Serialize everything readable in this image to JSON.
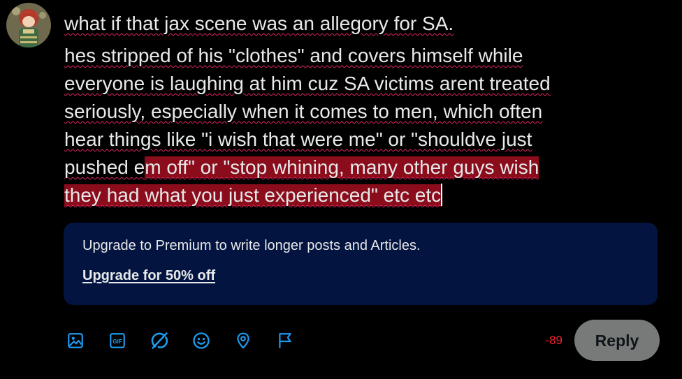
{
  "avatar": {
    "icon": "user-avatar"
  },
  "composer": {
    "lines": [
      "what if that jax scene was an allegory for SA.",
      "hes stripped of his \"clothes\" and covers himself while",
      "everyone is laughing at him cuz SA victims arent treated",
      "seriously, especially when it comes to men, which often",
      "hear things like \"i wish that were me\" or \"shouldve just"
    ],
    "line6_normal": "pushed e",
    "line6_highlight": "m off\" or \"stop whining, many other guys wish",
    "line7_highlight": "they had what you just experienced\" etc etc"
  },
  "premium": {
    "text": "Upgrade to Premium to write longer posts and Articles.",
    "link_label": "Upgrade for 50% off"
  },
  "toolbar": {
    "icons": [
      "image-icon",
      "gif-icon",
      "grok-icon",
      "emoji-icon",
      "location-icon",
      "flag-icon"
    ],
    "gif_label": "GIF"
  },
  "counter": {
    "value": "-89"
  },
  "reply_button": {
    "label": "Reply"
  },
  "colors": {
    "accent": "#1d9bf0",
    "premium_bg": "#041440",
    "highlight": "#8b0d1c",
    "over_limit": "#f4212e",
    "reply_disabled": "#787a7a"
  }
}
